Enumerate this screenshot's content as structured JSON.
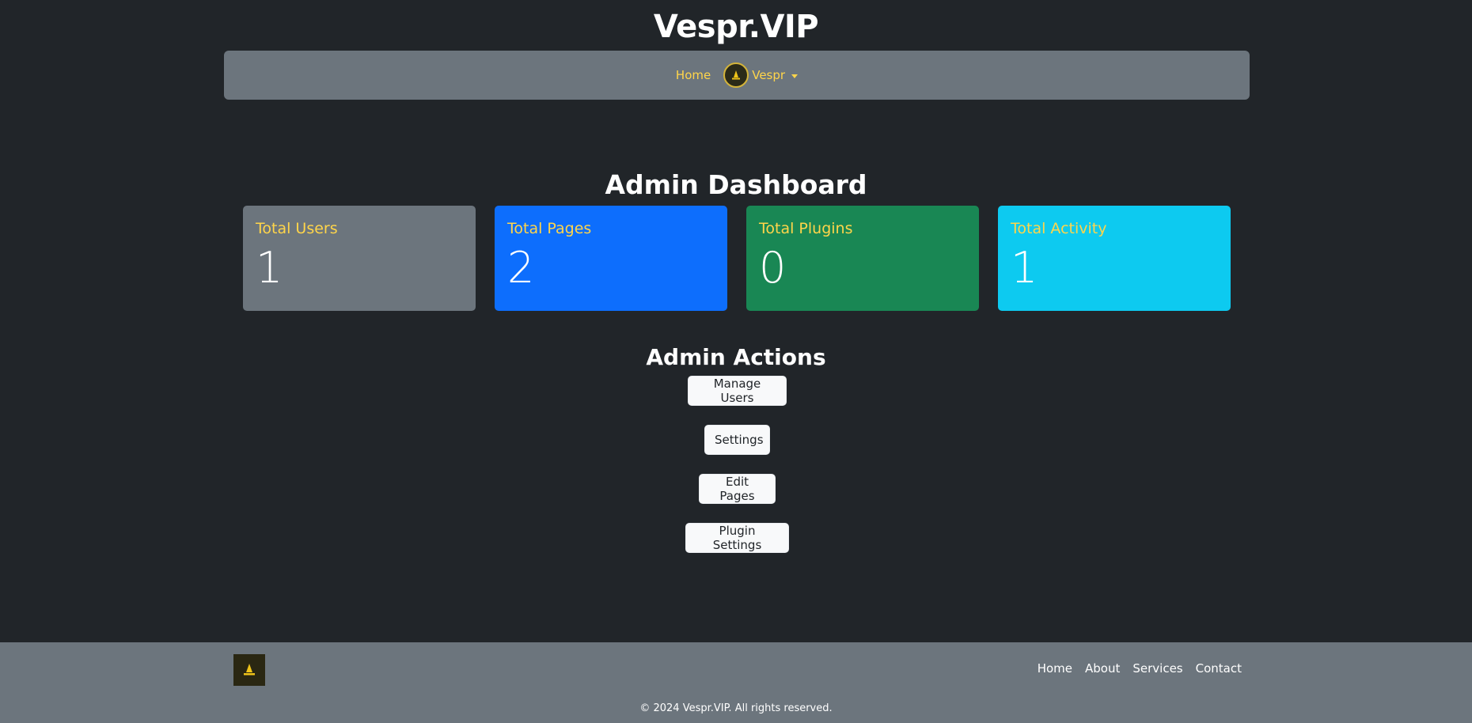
{
  "site": {
    "title": "Vespr.VIP"
  },
  "nav": {
    "home_label": "Home",
    "user_label": "Vespr"
  },
  "dashboard": {
    "title": "Admin Dashboard",
    "cards": [
      {
        "label": "Total Users",
        "value": "1",
        "color": "#6c757d"
      },
      {
        "label": "Total Pages",
        "value": "2",
        "color": "#0d6efd"
      },
      {
        "label": "Total Plugins",
        "value": "0",
        "color": "#198754"
      },
      {
        "label": "Total Activity",
        "value": "1",
        "color": "#0dcaf0"
      }
    ]
  },
  "actions": {
    "title": "Admin Actions",
    "buttons": [
      {
        "label": "Manage Users"
      },
      {
        "label": "Settings"
      },
      {
        "label": "Edit Pages"
      },
      {
        "label": "Plugin Settings"
      }
    ]
  },
  "footer": {
    "links": [
      {
        "label": "Home"
      },
      {
        "label": "About"
      },
      {
        "label": "Services"
      },
      {
        "label": "Contact"
      }
    ],
    "copyright": "© 2024 Vespr.VIP. All rights reserved."
  },
  "colors": {
    "accent": "#ffd54a",
    "background": "#212529",
    "navbar": "#6c757d"
  }
}
